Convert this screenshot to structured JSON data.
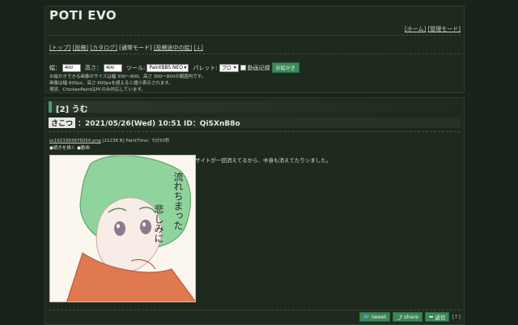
{
  "site": {
    "title": "POTI EVO"
  },
  "top_links": {
    "home": "[ホーム]",
    "admin": "[管理モード]"
  },
  "nav": {
    "top": "[トップ]",
    "post": "[投稿]",
    "catalog": "[カタログ]",
    "normal_mode": "[通常モード]",
    "drafts": "[投稿途中の絵]",
    "down": "[↓]"
  },
  "paint_form": {
    "width_label": "幅：",
    "width_value": "400",
    "height_label": "高さ：",
    "height_value": "400",
    "tool_label": "ツール:",
    "tool_value": "PaintBBS NEO",
    "palette_label": "パレット:",
    "palette_value": "プロ",
    "record_label": "動画記録",
    "submit_label": "お絵かき",
    "notes": [
      "お絵かきできる画像のサイズは幅 300～800、高さ 300～800の範囲内です。",
      "画像は幅 600px、高さ 600pxを超えると縮小表示されます。",
      "現状、ChickenPaintはPCのみ対応しています。"
    ]
  },
  "post": {
    "number_title": "[2] うむ",
    "author": "さこつ",
    "meta": "：2021/05/26(Wed) 10:51 ID：QiSXnB8o",
    "file_name": "sc1621993876050.png",
    "file_info": "[21238 B] PaintTime：5分50秒",
    "continue_label": "●続きを描く",
    "video_label": "●動画",
    "drawing_text": [
      "流れちまった",
      "悲しみに"
    ],
    "comment": "サイトが一回消えてるから、中身も消えてたりシました。",
    "buttons": {
      "tweet": "tweet",
      "share": "share",
      "reply": "返信",
      "up": "[↑]"
    }
  }
}
